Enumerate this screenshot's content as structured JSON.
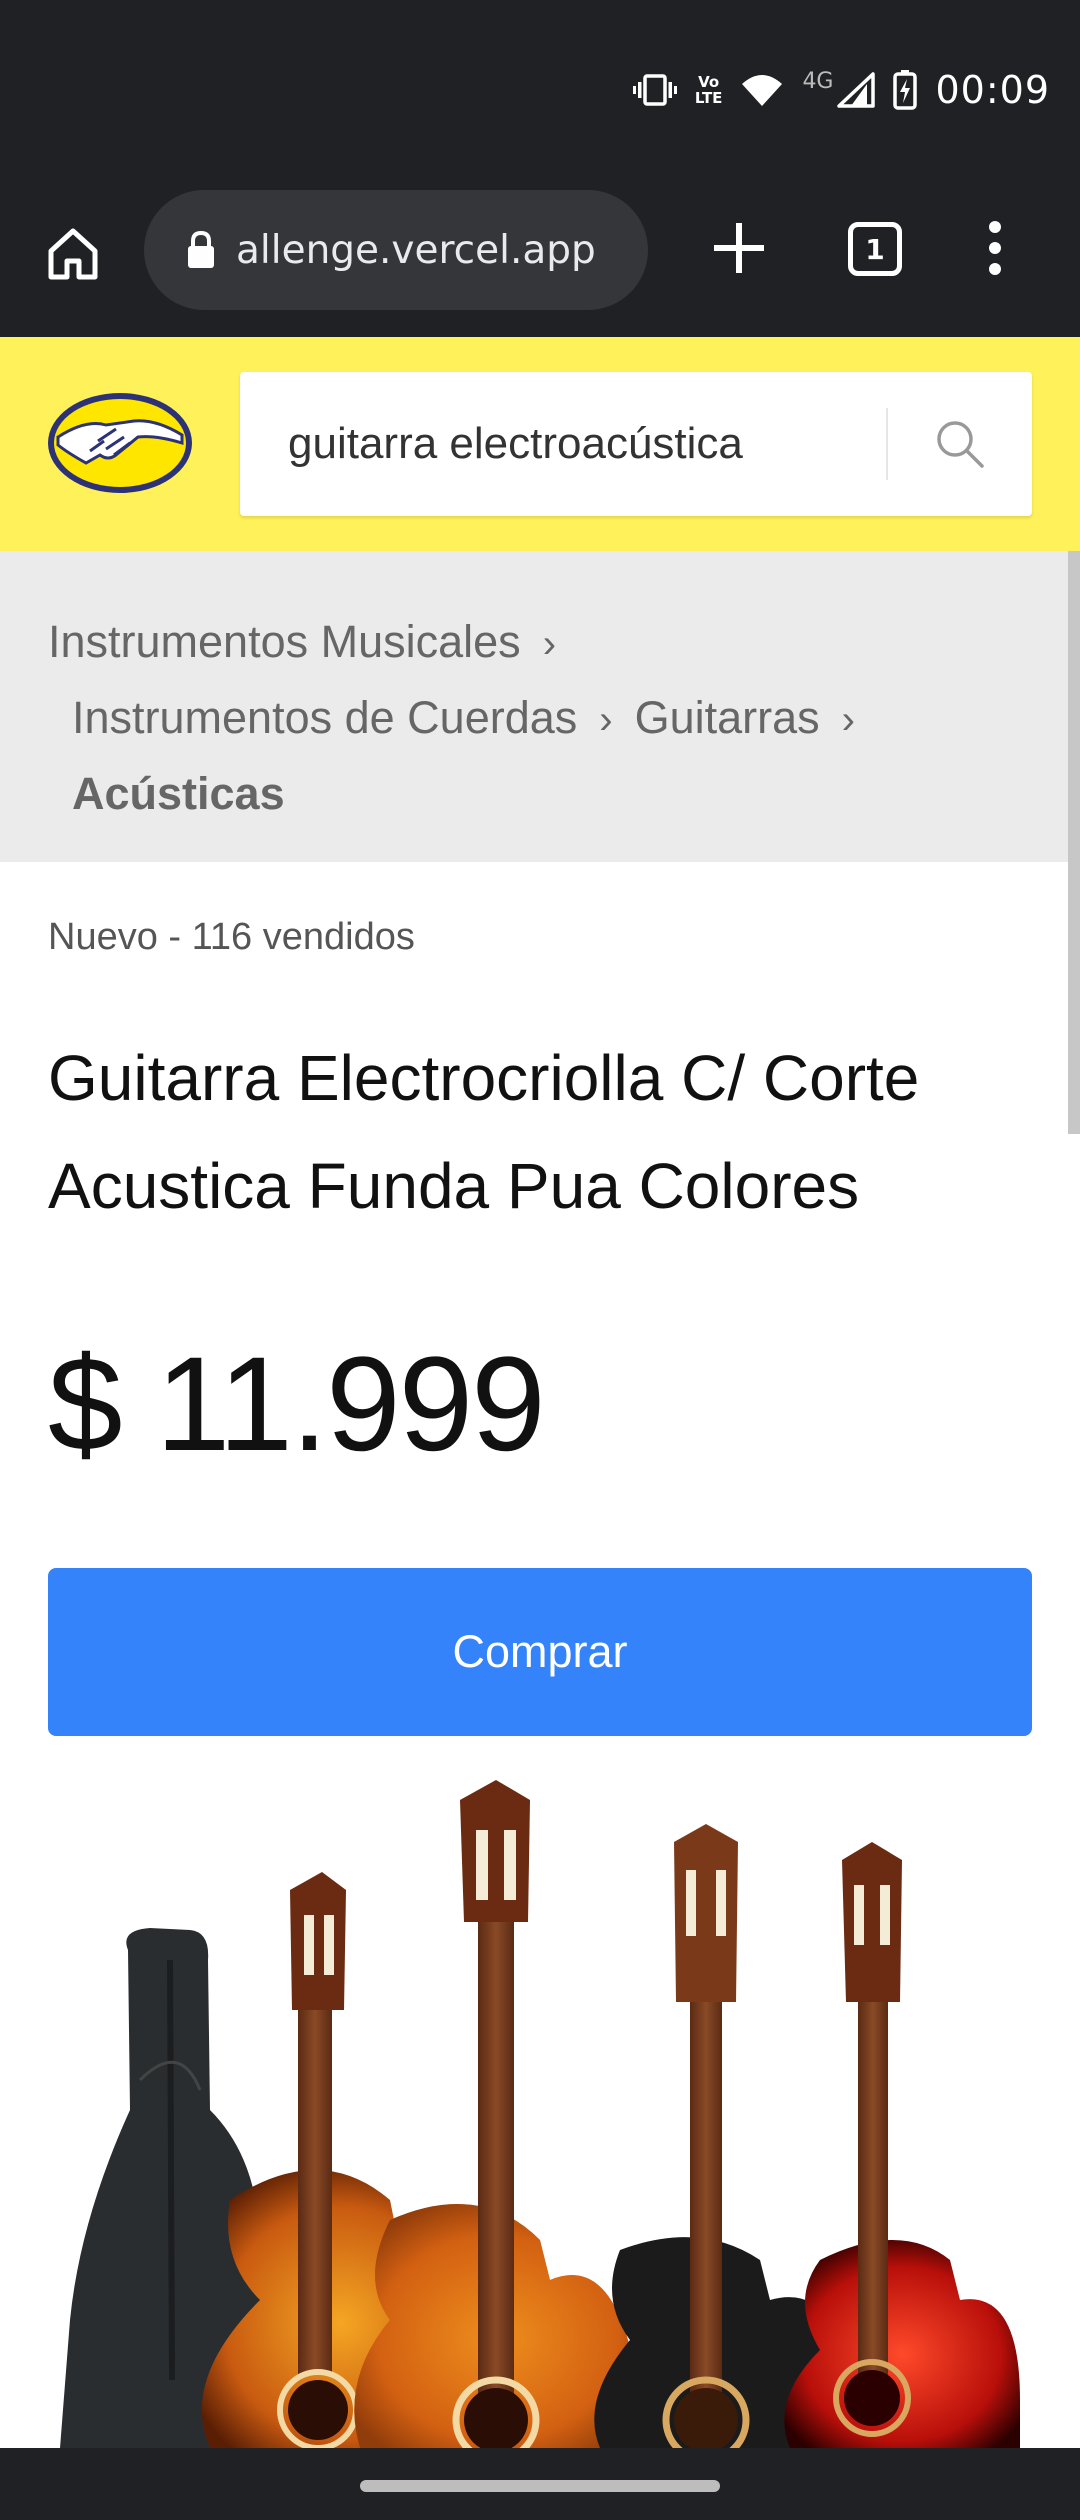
{
  "status_bar": {
    "time": "00:09",
    "network": "4G",
    "volte_top": "Vo",
    "volte_bottom": "LTE"
  },
  "browser": {
    "url": "allenge.vercel.app",
    "tab_count": "1"
  },
  "header": {
    "search_value": "guitarra electroacústica",
    "accent_color": "#fff159"
  },
  "breadcrumb": {
    "items": [
      "Instrumentos Musicales",
      "Instrumentos de Cuerdas",
      "Guitarras",
      "Acústicas"
    ],
    "separator": "›"
  },
  "product": {
    "condition": "Nuevo - 116 vendidos",
    "title": "Guitarra Electrocriolla C/ Corte Acustica Funda Pua Colores",
    "price": "$ 11.999",
    "buy_label": "Comprar",
    "button_color": "#3483fa",
    "image_icon": "guitars-product-image"
  }
}
